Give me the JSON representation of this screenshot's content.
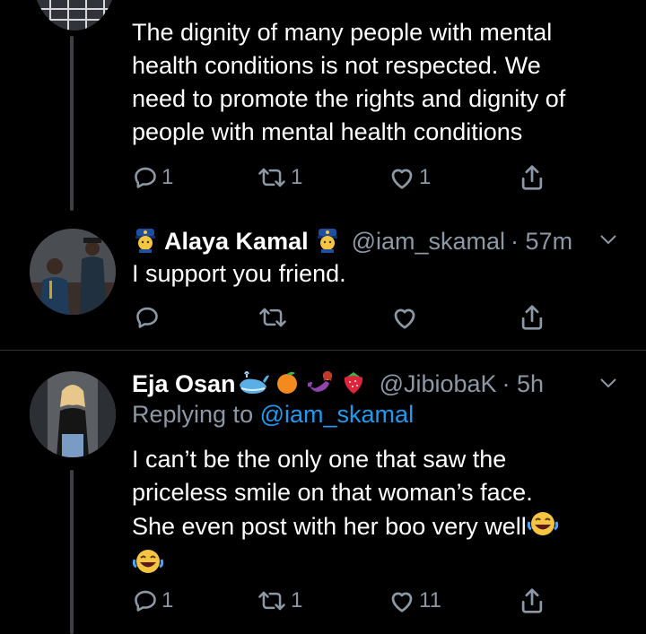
{
  "tweets": [
    {
      "text": "The dignity of many people with mental health conditions is not respected. We need to promote the rights and dignity of people with mental health conditions",
      "text_lines": [
        "The dignity of many people with mental",
        "health conditions is not respected. We",
        "need to promote the rights and dignity of",
        "people with mental health conditions"
      ],
      "replies": "1",
      "retweets": "1",
      "likes": "1"
    },
    {
      "name": "Alaya Kamal",
      "handle": "@iam_skamal",
      "time": "· 57m",
      "text": "I support you friend.",
      "replies": "",
      "retweets": "",
      "likes": ""
    },
    {
      "name": "Eja Osan",
      "handle": "@JibiobaK",
      "time": "· 5h",
      "replying_prefix": "Replying to",
      "replying_to": "@iam_skamal",
      "text_lines": [
        "I can’t be the only one that saw the",
        "priceless smile on that woman’s face.",
        "She even post with her boo very well"
      ],
      "replies": "1",
      "retweets": "1",
      "likes": "11"
    }
  ],
  "icons": [
    "reply-icon",
    "retweet-icon",
    "like-icon",
    "share-icon",
    "chevron-down-icon",
    "police-officer-emoji",
    "whale-emoji",
    "tangerine-emoji",
    "mermaid-emoji",
    "strawberry-emoji",
    "laughing-emoji"
  ],
  "colors": {
    "background": "#000000",
    "secondary_text": "#8b98a5",
    "link": "#1d9bf0",
    "divider": "#2f3336"
  }
}
